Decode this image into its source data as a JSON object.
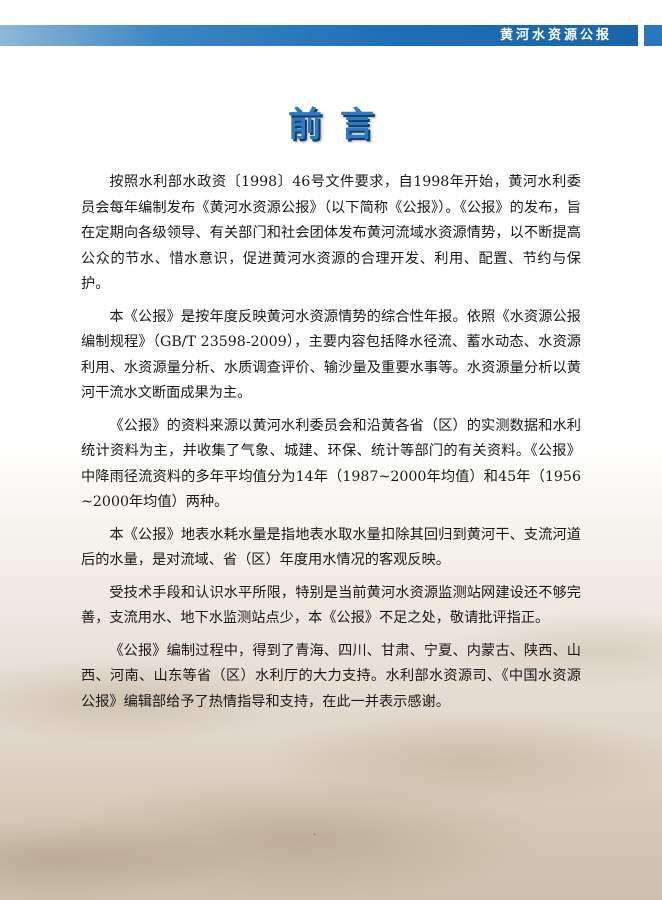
{
  "header": {
    "publication": "黄河水资源公报"
  },
  "page_title": "前言",
  "paragraphs": [
    "按照水利部水政资〔1998〕46号文件要求，自1998年开始，黄河水利委员会每年编制发布《黄河水资源公报》（以下简称《公报》）。《公报》的发布，旨在定期向各级领导、有关部门和社会团体发布黄河流域水资源情势，以不断提高公众的节水、惜水意识，促进黄河水资源的合理开发、利用、配置、节约与保护。",
    "本《公报》是按年度反映黄河水资源情势的综合性年报。依照《水资源公报编制规程》（GB/T 23598-2009），主要内容包括降水径流、蓄水动态、水资源利用、水资源量分析、水质调查评价、输沙量及重要水事等。水资源量分析以黄河干流水文断面成果为主。",
    "《公报》的资料来源以黄河水利委员会和沿黄各省（区）的实测数据和水利统计资料为主，并收集了气象、城建、环保、统计等部门的有关资料。《公报》中降雨径流资料的多年平均值分为14年（1987~2000年均值）和45年（1956~2000年均值）两种。",
    "本《公报》地表水耗水量是指地表水取水量扣除其回归到黄河干、支流河道后的水量，是对流域、省（区）年度用水情况的客观反映。",
    "受技术手段和认识水平所限，特别是当前黄河水资源监测站网建设还不够完善，支流用水、地下水监测站点少，本《公报》不足之处，敬请批评指正。",
    "《公报》编制过程中，得到了青海、四川、甘肃、宁夏、内蒙古、陕西、山西、河南、山东等省（区）水利厅的大力支持。水利部水资源司、《中国水资源公报》编辑部给予了热情指导和支持，在此一并表示感谢。"
  ],
  "footer_mark": "."
}
